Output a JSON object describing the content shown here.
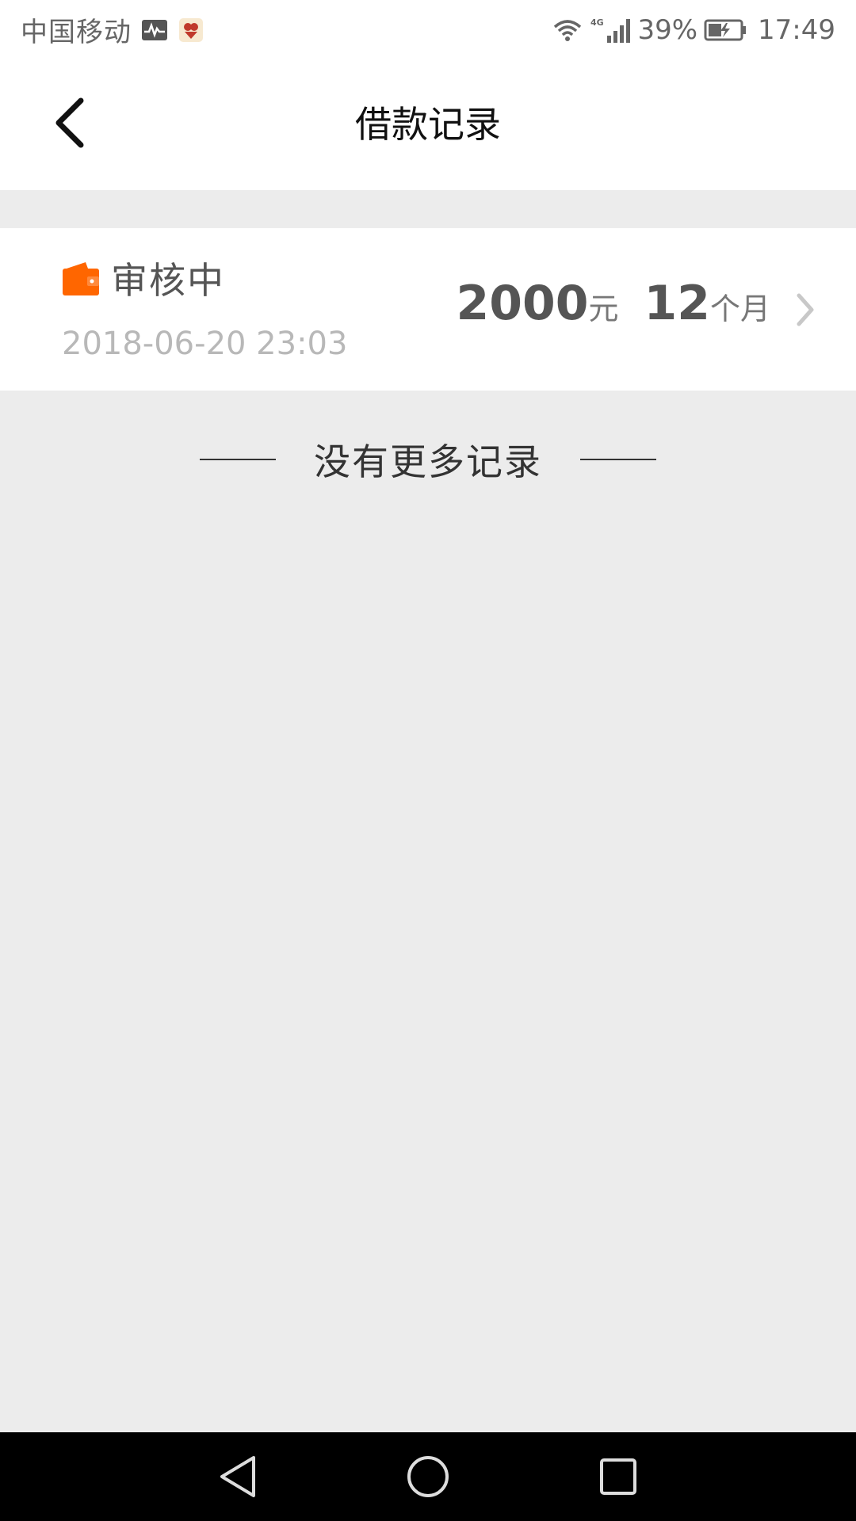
{
  "status_bar": {
    "carrier": "中国移动",
    "network": "4G",
    "battery_percent": "39%",
    "time": "17:49"
  },
  "nav": {
    "title": "借款记录"
  },
  "records": [
    {
      "status": "审核中",
      "date": "2018-06-20 23:03",
      "amount": "2000",
      "amount_unit": "元",
      "term": "12",
      "term_unit": "个月"
    }
  ],
  "footer": {
    "no_more_text": "没有更多记录"
  },
  "colors": {
    "accent": "#ff6600",
    "background": "#ececec",
    "card": "#ffffff"
  },
  "icons": {
    "back": "chevron-left-icon",
    "wallet": "wallet-icon",
    "record_arrow": "chevron-right-icon",
    "system_back": "triangle-back-icon",
    "system_home": "circle-home-icon",
    "system_recent": "square-recent-icon"
  }
}
